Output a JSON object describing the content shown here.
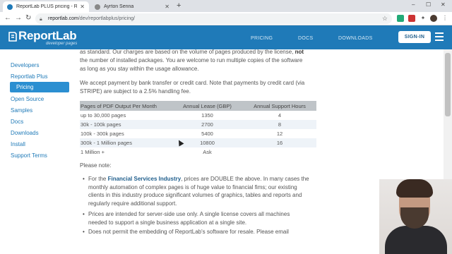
{
  "browser": {
    "tabs": [
      {
        "title": "ReportLab PLUS pricing - Report",
        "active": true
      },
      {
        "title": "Ayrton Senna",
        "active": false
      }
    ],
    "new_tab": "+",
    "url_host": "reportlab.com",
    "url_path": "/dev/reportlabplus/pricing/",
    "window_controls": {
      "minimize": "–",
      "maximize": "☐",
      "close": "✕"
    }
  },
  "header": {
    "logo": "ReportLab",
    "logo_sub": "developer pages",
    "nav": [
      "PRICING",
      "DOCS",
      "DOWNLOADS"
    ],
    "signin": "SIGN-IN",
    "colors": {
      "brand": "#1f7ab8",
      "active": "#2b8fd1"
    }
  },
  "sidebar": {
    "items": [
      {
        "label": "Developers"
      },
      {
        "label": "Reportlab Plus"
      },
      {
        "label": "Pricing",
        "active": true
      },
      {
        "label": "Open Source"
      },
      {
        "label": "Samples"
      },
      {
        "label": "Docs"
      },
      {
        "label": "Downloads"
      },
      {
        "label": "Install"
      },
      {
        "label": "Support Terms"
      }
    ]
  },
  "content": {
    "para1_line1_a": "as standard. Our charges are based on the volume of pages produced by the license, ",
    "para1_line1_b": "not",
    "para1_line2": "the number of installed packages. You are welcome to run multiple copies of the software",
    "para1_line3": "as long as you stay within the usage allowance.",
    "para2_line1": "We accept payment by bank transfer or credit card. Note that payments by credit card (via",
    "para2_line2": "STRIPE) are subject to a 2.5% handling fee.",
    "table": {
      "headers": [
        "Pages of PDF Output Per Month",
        "Annual Lease (GBP)",
        "Annual Support Hours"
      ],
      "rows": [
        [
          "up to 30,000 pages",
          "1350",
          "4"
        ],
        [
          "30k - 100k pages",
          "2700",
          "8"
        ],
        [
          "100k - 300k pages",
          "5400",
          "12"
        ],
        [
          "300k - 1 Million pages",
          "10800",
          "16"
        ],
        [
          "1 Million +",
          "Ask",
          ""
        ]
      ]
    },
    "note": "Please note:",
    "bullet1_a": "For the ",
    "bullet1_b": "Financial Services Industry",
    "bullet1_c": ", prices are DOUBLE the above.  In many cases the",
    "bullet1_line2": "monthly automation of complex pages is of huge value to financial fims; our existing",
    "bullet1_line3": "clients in this industry produce significant volumes of graphics, tables and reports and",
    "bullet1_line4": "regularly require additional support.",
    "bullet2_line1": "Prices are intended for server-side use only. A single license covers all machines",
    "bullet2_line2": "needed to support a single business application at a single site.",
    "bullet3_line1": "Does not permit the embedding of ReportLab's software for resale.  Please email"
  }
}
